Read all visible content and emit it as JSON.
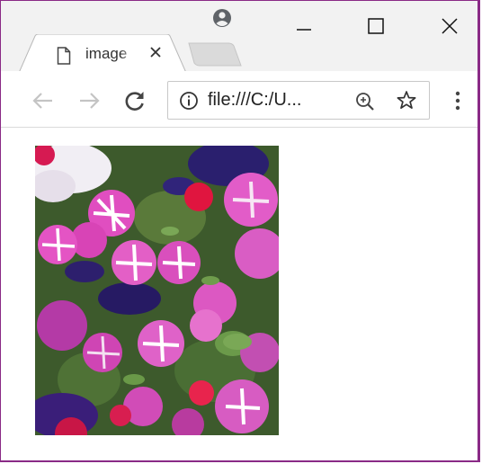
{
  "browser": {
    "tab": {
      "title": "image",
      "close_icon": "close-icon",
      "favicon": "page-icon"
    },
    "window_controls": {
      "profile_icon": "profile-icon",
      "minimize_icon": "minimize-icon",
      "maximize_icon": "maximize-icon",
      "close_icon": "close-icon"
    },
    "toolbar": {
      "back_icon": "back-arrow-icon",
      "forward_icon": "forward-arrow-icon",
      "reload_icon": "reload-icon",
      "url": "file:///C:/U...",
      "info_icon": "info-icon",
      "zoom_icon": "zoom-icon",
      "bookmark_icon": "star-icon",
      "menu_icon": "kebab-menu-icon"
    }
  },
  "content": {
    "image": "petunia-flowers-photo"
  },
  "colors": {
    "frame_border": "#8a2a86",
    "titlebar": "#f2f2f2",
    "toolbar": "#ffffff",
    "omnibox_border": "#c8c8c8"
  }
}
